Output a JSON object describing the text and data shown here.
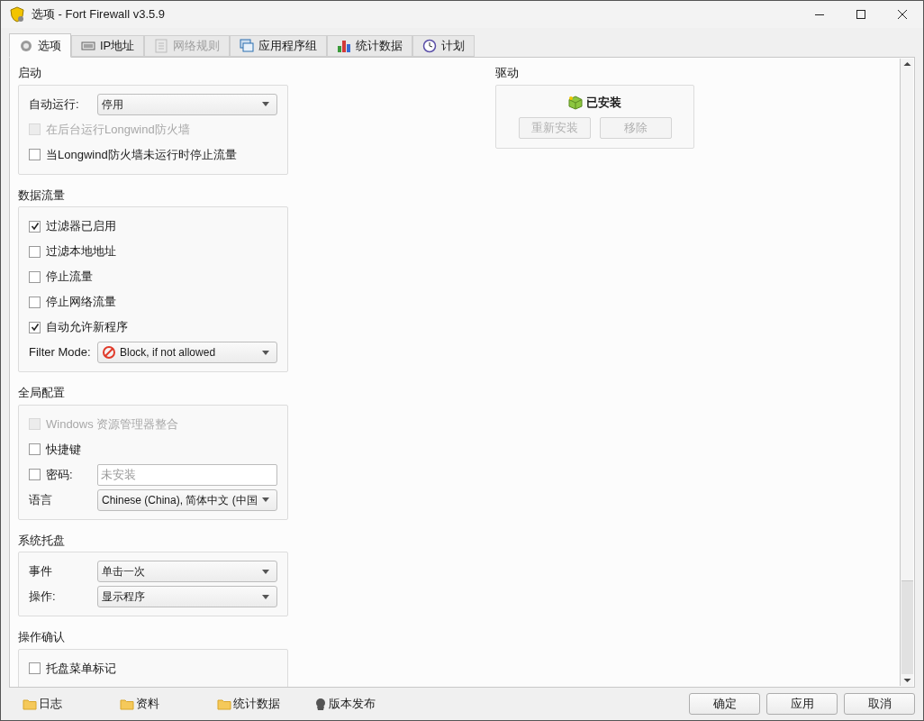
{
  "window": {
    "title": "选项 - Fort Firewall v3.5.9"
  },
  "tabs": [
    {
      "label": "选项",
      "selected": true,
      "disabled": false
    },
    {
      "label": "IP地址",
      "selected": false,
      "disabled": false
    },
    {
      "label": "网络规则",
      "selected": false,
      "disabled": true
    },
    {
      "label": "应用程序组",
      "selected": false,
      "disabled": false
    },
    {
      "label": "统计数据",
      "selected": false,
      "disabled": false
    },
    {
      "label": "计划",
      "selected": false,
      "disabled": false
    }
  ],
  "groups": [
    {
      "title": "启动",
      "rows": [
        {
          "kind": "select",
          "label": "自动运行:",
          "value": "停用"
        },
        {
          "kind": "checkbox",
          "label": "在后台运行Longwind防火墙",
          "checked": false,
          "disabled": true
        },
        {
          "kind": "checkbox",
          "label": "当Longwind防火墙未运行时停止流量",
          "checked": false,
          "disabled": false
        }
      ]
    },
    {
      "title": "数据流量",
      "rows": [
        {
          "kind": "checkbox",
          "label": "过滤器已启用",
          "checked": true,
          "disabled": false
        },
        {
          "kind": "checkbox",
          "label": "过滤本地地址",
          "checked": false,
          "disabled": false
        },
        {
          "kind": "checkbox",
          "label": "停止流量",
          "checked": false,
          "disabled": false
        },
        {
          "kind": "checkbox",
          "label": "停止网络流量",
          "checked": false,
          "disabled": false
        },
        {
          "kind": "checkbox",
          "label": "自动允许新程序",
          "checked": true,
          "disabled": false
        },
        {
          "kind": "select_block",
          "label": "Filter Mode:",
          "value": "Block, if not allowed"
        }
      ]
    },
    {
      "title": "全局配置",
      "rows": [
        {
          "kind": "checkbox",
          "label": "Windows 资源管理器整合",
          "checked": false,
          "disabled": true
        },
        {
          "kind": "checkbox",
          "label": "快捷键",
          "checked": false,
          "disabled": false
        },
        {
          "kind": "checkbox_field",
          "label": "密码:",
          "checked": false,
          "placeholder": "未安装"
        },
        {
          "kind": "select",
          "label": "语言",
          "value": "Chinese (China), 简体中文 (中国"
        }
      ]
    },
    {
      "title": "系统托盘",
      "rows": [
        {
          "kind": "select",
          "label": "事件",
          "value": "单击一次"
        },
        {
          "kind": "select",
          "label": "操作:",
          "value": "显示程序"
        }
      ]
    },
    {
      "title": "操作确认",
      "rows": [
        {
          "kind": "checkbox",
          "label": "托盘菜单标记",
          "checked": false,
          "disabled": false
        }
      ]
    }
  ],
  "driver": {
    "title": "驱动",
    "status": "已安装",
    "buttons": [
      {
        "label": "重新安装",
        "disabled": true
      },
      {
        "label": "移除",
        "disabled": true
      }
    ]
  },
  "bottom_links": [
    {
      "label": "日志"
    },
    {
      "label": "资料"
    },
    {
      "label": "统计数据"
    },
    {
      "label": "版本发布"
    }
  ],
  "dialog_buttons": [
    {
      "label": "确定"
    },
    {
      "label": "应用"
    },
    {
      "label": "取消"
    }
  ]
}
